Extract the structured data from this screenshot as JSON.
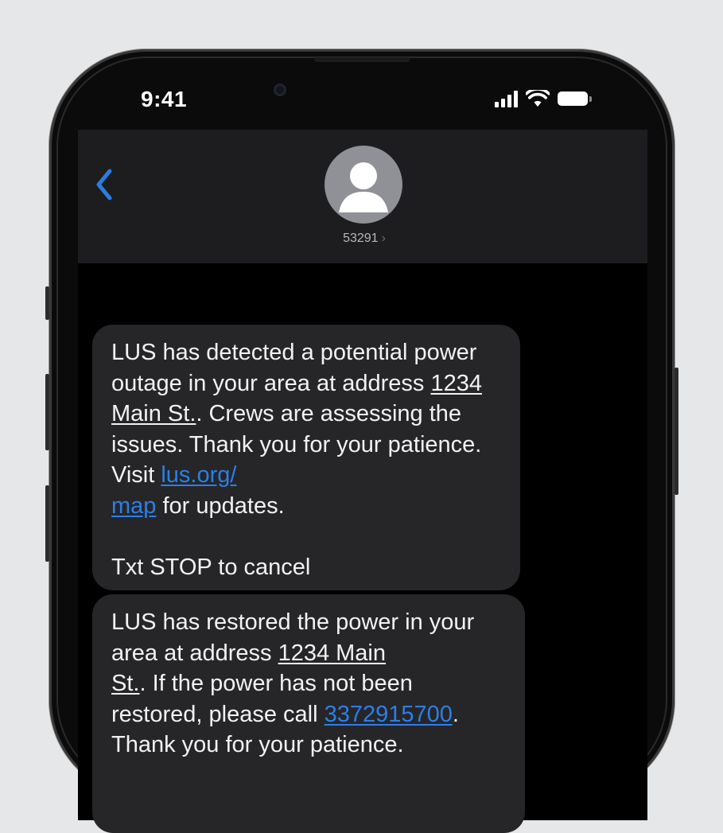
{
  "status_bar": {
    "time": "9:41"
  },
  "header": {
    "contact": "53291",
    "contact_chevron": "›",
    "back_icon": "chevron-left-icon",
    "avatar_icon": "person-icon"
  },
  "messages": [
    {
      "p1": "LUS has detected a potential power outage in your area at address ",
      "address": "1234 Main St.",
      "p2": ". Crews are assessing the issues. Thank you for your patience. Visit ",
      "link_a": "lus.org/",
      "link_b": "map",
      "p3": " for updates.",
      "stop": "Txt STOP to cancel"
    },
    {
      "p1": "LUS has restored the power in your area at address ",
      "address_a": "1234 Main",
      "address_b": "St.",
      "p2": ".  If the power has not been restored, please call ",
      "phone": "3372915700",
      "p3": ". Thank you for your patience."
    }
  ],
  "colors": {
    "background": "#e6e7e8",
    "header": "#1d1d1f",
    "bubble": "#262629",
    "link": "#2c7fe8",
    "accent": "#2b7de0"
  }
}
